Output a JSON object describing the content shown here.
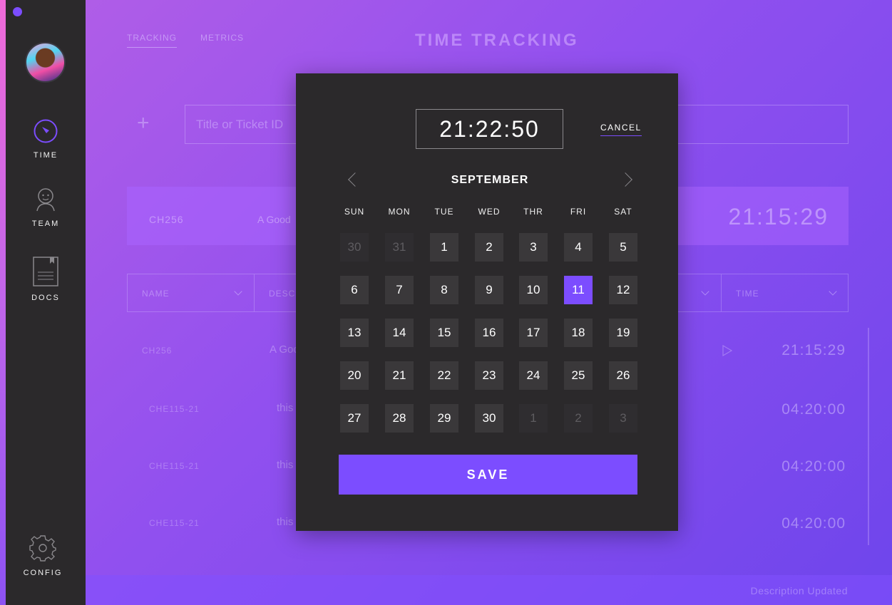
{
  "sidebar": {
    "items": [
      {
        "label": "TIME",
        "icon": "timer-icon"
      },
      {
        "label": "TEAM",
        "icon": "person-icon"
      },
      {
        "label": "DOCS",
        "icon": "document-icon"
      },
      {
        "label": "CONFIG",
        "icon": "gear-icon"
      }
    ]
  },
  "header": {
    "tabs": [
      "TRACKING",
      "METRICS"
    ],
    "title": "TIME TRACKING"
  },
  "new_entry": {
    "placeholder": "Title or Ticket ID"
  },
  "active_entry": {
    "ticket": "CH256",
    "description": "A Good",
    "timer": "21:15:29"
  },
  "columns": {
    "name": "NAME",
    "description": "DESC",
    "time": "TIME"
  },
  "rows": [
    {
      "ticket": "CH256",
      "description": "A Good",
      "duration": "21:15:29"
    },
    {
      "ticket": "CHE115-21",
      "description": "this",
      "duration": "04:20:00"
    },
    {
      "ticket": "CHE115-21",
      "description": "this",
      "duration": "04:20:00"
    },
    {
      "ticket": "CHE115-21",
      "description": "this",
      "duration": "04:20:00"
    }
  ],
  "footer": {
    "status": "Description Updated"
  },
  "modal": {
    "time_value": "21:22:50",
    "cancel_label": "CANCEL",
    "month": "SEPTEMBER",
    "weekdays": [
      "SUN",
      "MON",
      "TUE",
      "WED",
      "THR",
      "FRI",
      "SAT"
    ],
    "days": [
      [
        "30",
        "31",
        "1",
        "2",
        "3",
        "4",
        "5"
      ],
      [
        "6",
        "7",
        "8",
        "9",
        "10",
        "11",
        "12"
      ],
      [
        "13",
        "14",
        "15",
        "16",
        "17",
        "18",
        "19"
      ],
      [
        "20",
        "21",
        "22",
        "23",
        "24",
        "25",
        "26"
      ],
      [
        "27",
        "28",
        "29",
        "30",
        "1",
        "2",
        "3"
      ]
    ],
    "selected_day": "11",
    "save_label": "SAVE"
  },
  "colors": {
    "accent": "#7c4dff",
    "modal_bg": "#2b292b",
    "sidebar_bg": "#2b292b"
  }
}
